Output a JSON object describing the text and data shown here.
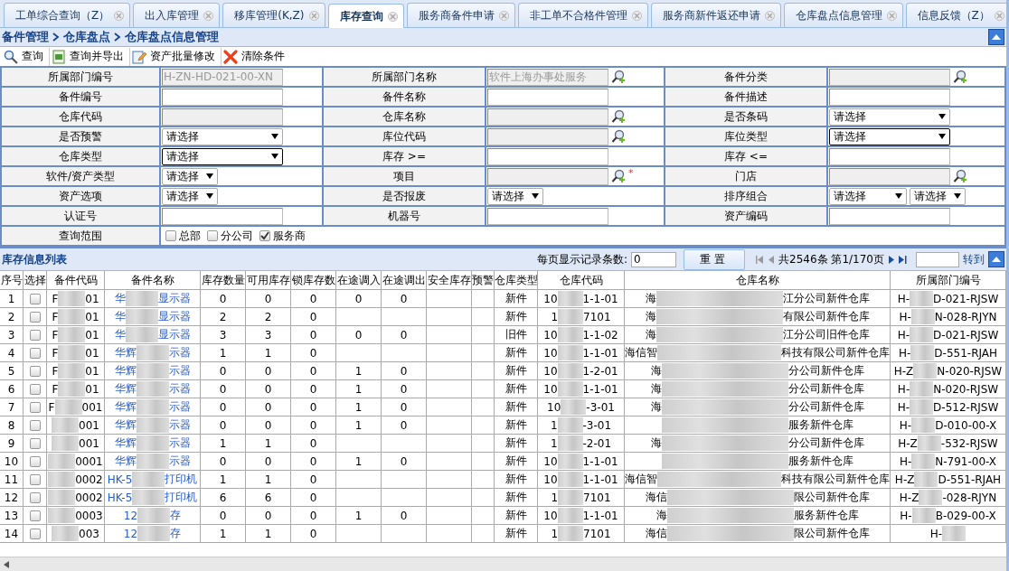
{
  "tabs": [
    {
      "label": "工单综合查询（Z）",
      "selected": false
    },
    {
      "label": "出入库管理",
      "selected": false
    },
    {
      "label": "移库管理(K,Z)",
      "selected": false
    },
    {
      "label": "库存查询",
      "selected": true
    },
    {
      "label": "服务商备件申请",
      "selected": false
    },
    {
      "label": "非工单不合格件管理",
      "selected": false
    },
    {
      "label": "服务商新件返还申请",
      "selected": false
    },
    {
      "label": "仓库盘点信息管理",
      "selected": false
    },
    {
      "label": "信息反馈（Z）",
      "selected": false
    }
  ],
  "breadcrumb": [
    "备件管理",
    "仓库盘点",
    "仓库盘点信息管理"
  ],
  "toolbar": [
    {
      "kind": "search",
      "label": "查询"
    },
    {
      "kind": "export",
      "label": "查询并导出"
    },
    {
      "kind": "edit",
      "label": "资产批量修改"
    },
    {
      "kind": "clear",
      "label": "清除条件"
    }
  ],
  "form": [
    [
      {
        "label": "所属部门编号",
        "kind": "text",
        "value": "H-ZN-HD-021-00-XN",
        "disabled": true
      },
      {
        "label": "所属部门名称",
        "kind": "text",
        "value": "软件上海办事处服务",
        "disabled": true,
        "lookup": true
      },
      {
        "label": "备件分类",
        "kind": "text",
        "disabled": true,
        "lookup": true
      }
    ],
    [
      {
        "label": "备件编号",
        "kind": "text",
        "disabled": false
      },
      {
        "label": "备件名称",
        "kind": "text",
        "disabled": false
      },
      {
        "label": "备件描述",
        "kind": "text",
        "disabled": false
      }
    ],
    [
      {
        "label": "仓库代码",
        "kind": "text",
        "disabled": true
      },
      {
        "label": "仓库名称",
        "kind": "text",
        "disabled": true,
        "lookup": true
      },
      {
        "label": "是否条码",
        "kind": "select",
        "value": "请选择",
        "focused": false
      }
    ],
    [
      {
        "label": "是否预警",
        "kind": "select",
        "value": "请选择",
        "focused": false
      },
      {
        "label": "库位代码",
        "kind": "text",
        "disabled": true,
        "lookup": true
      },
      {
        "label": "库位类型",
        "kind": "select",
        "value": "请选择",
        "focused": true
      }
    ],
    [
      {
        "label": "仓库类型",
        "kind": "select",
        "value": "请选择",
        "focused": true
      },
      {
        "label": "库存 >=",
        "kind": "text",
        "disabled": false
      },
      {
        "label": "库存 <=",
        "kind": "text",
        "disabled": false
      }
    ],
    [
      {
        "label": "软件/资产类型",
        "kind": "small-select",
        "value": "请选择"
      },
      {
        "label": "项目",
        "kind": "text",
        "disabled": true,
        "lookup": true,
        "required_mark": "*"
      },
      {
        "label": "门店",
        "kind": "text",
        "disabled": true,
        "lookup": true
      }
    ],
    [
      {
        "label": "资产选项",
        "kind": "small-select",
        "value": "请选择"
      },
      {
        "label": "是否报废",
        "kind": "small-select",
        "value": "请选择"
      },
      {
        "label": "排序组合",
        "kind": "select-pair",
        "values": [
          "请选择",
          "请选择"
        ]
      }
    ],
    [
      {
        "label": "认证号",
        "kind": "text",
        "disabled": false
      },
      {
        "label": "机器号",
        "kind": "text",
        "disabled": false
      },
      {
        "label": "资产编码",
        "kind": "text",
        "disabled": false
      }
    ],
    [
      {
        "label": "查询范围",
        "kind": "checks",
        "options": [
          {
            "label": "总部",
            "checked": false
          },
          {
            "label": "分公司",
            "checked": false
          },
          {
            "label": "服务商",
            "checked": true
          }
        ]
      }
    ]
  ],
  "list": {
    "title": "库存信息列表",
    "page_size_label": "每页显示记录条数:",
    "page_size": "0",
    "reset": "重置",
    "summary": "共2546条 第1/170页",
    "goto": "转到"
  },
  "columns": [
    "序号",
    "选择",
    "备件代码",
    "备件名称",
    "库存数量",
    "可用库存",
    "锁库存数",
    "在途调入",
    "在途调出",
    "安全库存",
    "预警",
    "仓库类型",
    "仓库代码",
    "仓库名称",
    "所属部门编号"
  ],
  "rows": [
    {
      "no": "1",
      "selected": false,
      "code": {
        "start": "F",
        "end": "01"
      },
      "name": {
        "start": "华",
        "end": "显示器"
      },
      "qty": [
        "0",
        "0",
        "0",
        "0",
        "0"
      ],
      "type": "新件",
      "wh_code": {
        "start": "10",
        "end": "1-1-01"
      },
      "wh_name": {
        "start": "海",
        "end": "江分公司新件仓库"
      },
      "dept": {
        "start": "H-",
        "end": "D-021-RJSW"
      }
    },
    {
      "no": "2",
      "selected": false,
      "code": {
        "start": "F",
        "end": "01"
      },
      "name": {
        "start": "华",
        "end": "显示器"
      },
      "qty": [
        "2",
        "2",
        "0"
      ],
      "type": "新件",
      "wh_code": {
        "start": "1",
        "end": "7101"
      },
      "wh_name": {
        "start": "海",
        "end": "有限公司新件仓库"
      },
      "dept": {
        "start": "H-",
        "end": "N-028-RJYN"
      }
    },
    {
      "no": "3",
      "selected": false,
      "code": {
        "start": "F",
        "end": "01"
      },
      "name": {
        "start": "华",
        "end": "显示器"
      },
      "qty": [
        "3",
        "3",
        "0",
        "0",
        "0"
      ],
      "type": "旧件",
      "wh_code": {
        "start": "10",
        "end": "1-1-02"
      },
      "wh_name": {
        "start": "海",
        "end": "江分公司旧件仓库"
      },
      "dept": {
        "start": "H-",
        "end": "D-021-RJSW"
      }
    },
    {
      "no": "4",
      "selected": false,
      "code": {
        "start": "F",
        "end": "01"
      },
      "name": {
        "start": "华辉",
        "end": "示器"
      },
      "qty": [
        "1",
        "1",
        "0"
      ],
      "type": "新件",
      "wh_code": {
        "start": "10",
        "end": "1-1-01"
      },
      "wh_name": {
        "start": "海信智",
        "end": "科技有限公司新件仓库"
      },
      "dept": {
        "start": "H-",
        "end": "D-551-RJAH"
      }
    },
    {
      "no": "5",
      "selected": false,
      "code": {
        "start": "F",
        "end": "01"
      },
      "name": {
        "start": "华辉",
        "end": "示器"
      },
      "qty": [
        "0",
        "0",
        "0",
        "1",
        "0"
      ],
      "type": "新件",
      "wh_code": {
        "start": "10",
        "end": "1-2-01"
      },
      "wh_name": {
        "start": "海",
        "end": "分公司新件仓库"
      },
      "dept": {
        "start": "H-Z",
        "end": "N-020-RJSW"
      }
    },
    {
      "no": "6",
      "selected": false,
      "code": {
        "start": "F",
        "end": "01"
      },
      "name": {
        "start": "华辉",
        "end": "示器"
      },
      "qty": [
        "0",
        "0",
        "0",
        "1",
        "0"
      ],
      "type": "新件",
      "wh_code": {
        "start": "10",
        "end": "1-1-01"
      },
      "wh_name": {
        "start": "海",
        "end": "分公司新件仓库"
      },
      "dept": {
        "start": "H-",
        "end": "N-020-RJSW"
      }
    },
    {
      "no": "7",
      "selected": false,
      "code": {
        "start": "F",
        "end": "001"
      },
      "name": {
        "start": "华辉",
        "end": "示器"
      },
      "qty": [
        "0",
        "0",
        "0",
        "1",
        "0"
      ],
      "type": "新件",
      "wh_code": {
        "start": "10",
        "end": "-3-01"
      },
      "wh_name": {
        "start": "海",
        "end": "分公司新件仓库"
      },
      "dept": {
        "start": "H-",
        "end": "D-512-RJSW"
      }
    },
    {
      "no": "8",
      "selected": false,
      "code": {
        "end": "001"
      },
      "name": {
        "start": "华辉",
        "end": "示器"
      },
      "qty": [
        "0",
        "0",
        "0",
        "1",
        "0"
      ],
      "type": "新件",
      "wh_code": {
        "start": "1",
        "end": "-3-01"
      },
      "wh_name": {
        "end": "服务新件仓库"
      },
      "dept": {
        "start": "H-",
        "end": "D-010-00-X"
      }
    },
    {
      "no": "9",
      "selected": false,
      "code": {
        "end": "001"
      },
      "name": {
        "start": "华辉",
        "end": "示器"
      },
      "qty": [
        "1",
        "1",
        "0"
      ],
      "type": "新件",
      "wh_code": {
        "start": "1",
        "end": "-2-01"
      },
      "wh_name": {
        "start": "海",
        "end": "分公司新件仓库"
      },
      "dept": {
        "start": "H-Z",
        "end": "-532-RJSW"
      }
    },
    {
      "no": "10",
      "selected": false,
      "code": {
        "end": "0001"
      },
      "name": {
        "start": "华辉",
        "end": "示器"
      },
      "qty": [
        "0",
        "0",
        "0",
        "1",
        "0"
      ],
      "type": "新件",
      "wh_code": {
        "start": "10",
        "end": "1-1-01"
      },
      "wh_name": {
        "end": "服务新件仓库"
      },
      "dept": {
        "start": "H-",
        "end": "N-791-00-X"
      }
    },
    {
      "no": "11",
      "selected": false,
      "code": {
        "end": "0002"
      },
      "name": {
        "start": "HK-5",
        "end": "打印机"
      },
      "qty": [
        "1",
        "1",
        "0"
      ],
      "type": "新件",
      "wh_code": {
        "start": "10",
        "end": "1-1-01"
      },
      "wh_name": {
        "start": "海信智",
        "end": "科技有限公司新件仓库"
      },
      "dept": {
        "start": "H-Z",
        "end": "D-551-RJAH"
      }
    },
    {
      "no": "12",
      "selected": false,
      "code": {
        "end": "0002"
      },
      "name": {
        "start": "HK-5",
        "end": "打印机"
      },
      "qty": [
        "6",
        "6",
        "0"
      ],
      "type": "新件",
      "wh_code": {
        "start": "1",
        "end": "7101"
      },
      "wh_name": {
        "start": "海信",
        "end": "限公司新件仓库"
      },
      "dept": {
        "start": "H-Z",
        "end": "-028-RJYN"
      }
    },
    {
      "no": "13",
      "selected": false,
      "code": {
        "end": "0003"
      },
      "name": {
        "start": "12",
        "end": "存"
      },
      "qty": [
        "0",
        "0",
        "0",
        "1",
        "0"
      ],
      "type": "新件",
      "wh_code": {
        "start": "10",
        "end": "1-1-01"
      },
      "wh_name": {
        "start": "海",
        "end": "服务新件仓库"
      },
      "dept": {
        "start": "H-",
        "end": "B-029-00-X"
      }
    },
    {
      "no": "14",
      "selected": false,
      "code": {
        "end": "003"
      },
      "name": {
        "start": "12",
        "end": "存"
      },
      "qty": [
        "1",
        "1",
        "0"
      ],
      "type": "新件",
      "wh_code": {
        "start": "1",
        "end": "7101"
      },
      "wh_name": {
        "start": "海信",
        "end": "限公司新件仓库"
      },
      "dept": {
        "start": "H-"
      }
    }
  ]
}
